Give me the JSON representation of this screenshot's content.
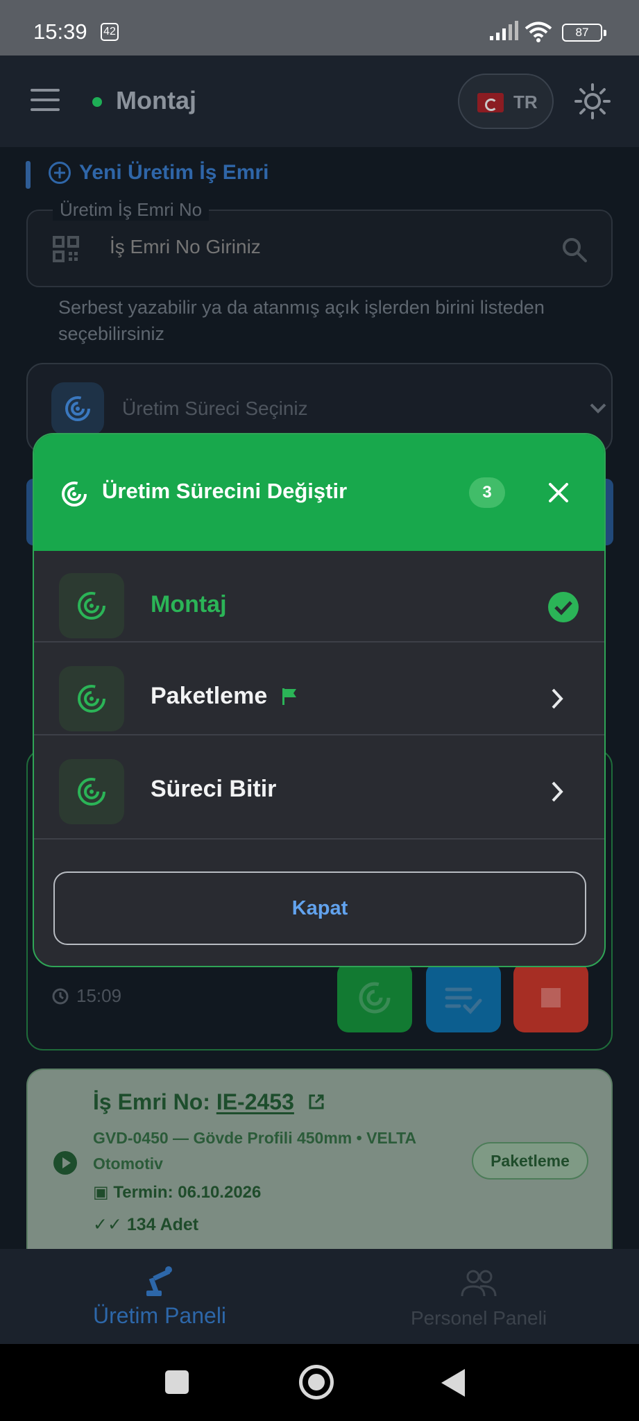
{
  "status_bar": {
    "time": "15:39",
    "notification_count": "42",
    "battery": "87"
  },
  "app_bar": {
    "current_process": "Montaj",
    "language": "TR"
  },
  "new_order": {
    "section_title": "Yeni Üretim İş Emri",
    "field_label": "Üretim İş Emri No",
    "field_placeholder": "İş Emri No Giriniz",
    "helper_text": "Serbest yazabilir ya da atanmış açık işlerden birini listeden seçebilirsiniz",
    "process_select_placeholder": "Üretim Süreci Seçiniz"
  },
  "active_card": {
    "time": "15:09"
  },
  "order_card": {
    "title_prefix": "İş Emri No: ",
    "order_no": "IE-2453",
    "description": "GVD-0450 — Gövde Profili 450mm  •  VELTA Otomotiv",
    "term": "Termin: 06.10.2026",
    "quantity": "134 Adet",
    "badge": "Paketleme"
  },
  "modal": {
    "title": "Üretim Sürecini Değiştir",
    "count": "3",
    "items": [
      {
        "label": "Montaj",
        "state": "selected"
      },
      {
        "label": "Paketleme",
        "state": "flagged"
      },
      {
        "label": "Süreci Bitir",
        "state": "normal"
      }
    ],
    "close_label": "Kapat"
  },
  "bottom_nav": {
    "items": [
      {
        "label": "Üretim Paneli",
        "active": true
      },
      {
        "label": "Personel Paneli",
        "active": false
      }
    ]
  },
  "colors": {
    "accent_green": "#18a84c",
    "accent_blue": "#2d67a9",
    "link_blue": "#62a3ee",
    "danger_red": "#a72e24"
  },
  "icons": {
    "process": "radar-target-icon",
    "selected": "check-circle-icon",
    "flag": "flag-icon",
    "next": "chevron-right-icon"
  }
}
